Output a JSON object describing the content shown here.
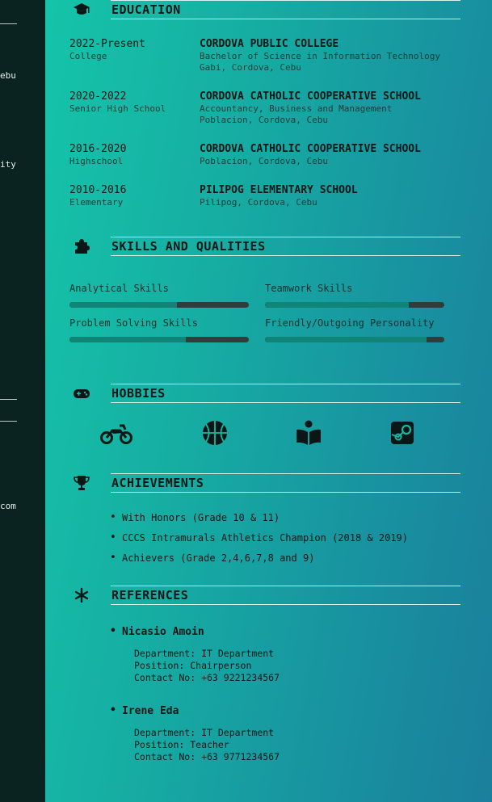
{
  "sidebar": {
    "fragments": [
      "ebu",
      "ity",
      "com"
    ]
  },
  "education": {
    "title": "EDUCATION",
    "icon": "graduation-cap-icon",
    "entries": [
      {
        "years": "2022-Present",
        "level": "College",
        "school": "CORDOVA PUBLIC COLLEGE",
        "line1": "Bachelor of Science in Information Technology",
        "line2": "Gabi, Cordova, Cebu"
      },
      {
        "years": "2020-2022",
        "level": "Senior High School",
        "school": "CORDOVA CATHOLIC COOPERATIVE SCHOOL",
        "line1": "Accountancy, Business and Management",
        "line2": "Poblacion, Cordova, Cebu"
      },
      {
        "years": "2016-2020",
        "level": "Highschool",
        "school": "CORDOVA CATHOLIC COOPERATIVE SCHOOL",
        "line1": "Poblacion, Cordova, Cebu",
        "line2": ""
      },
      {
        "years": "2010-2016",
        "level": "Elementary",
        "school": "PILIPOG ELEMENTARY SCHOOL",
        "line1": "Pilipog, Cordova, Cebu",
        "line2": ""
      }
    ]
  },
  "skills": {
    "title": "SKILLS AND QUALITIES",
    "icon": "puzzle-icon",
    "items": [
      {
        "label": "Analytical Skills",
        "level": 0.6
      },
      {
        "label": "Teamwork Skills",
        "level": 0.8
      },
      {
        "label": "Problem Solving Skills",
        "level": 0.65
      },
      {
        "label": "Friendly/Outgoing Personality",
        "level": 0.9
      }
    ]
  },
  "hobbies": {
    "title": "HOBBIES",
    "icon": "gamepad-icon",
    "items": [
      "motorcycle-icon",
      "basketball-icon",
      "book-reader-icon",
      "steam-icon"
    ]
  },
  "achievements": {
    "title": "ACHIEVEMENTS",
    "icon": "trophy-icon",
    "items": [
      "With Honors (Grade 10 & 11)",
      "CCCS Intramurals Athletics Champion (2018 & 2019)",
      "Achievers (Grade 2,4,6,7,8 and 9)"
    ]
  },
  "references": {
    "title": "REFERENCES",
    "icon": "asterisk-icon",
    "items": [
      {
        "name": "Nicasio Amoin",
        "department": "Department: IT Department",
        "position": "Position: Chairperson",
        "contact": "Contact No: +63 9221234567"
      },
      {
        "name": "Irene Eda",
        "department": "Department: IT Department",
        "position": "Position: Teacher",
        "contact": "Contact No: +63 9771234567"
      }
    ]
  },
  "colors": {
    "gradient_start": "#15c4a9",
    "gradient_end": "#1a7f9c",
    "sidebar_bg": "#0a2220",
    "bar_fill": "#108476",
    "bar_track": "#2f3d3b"
  }
}
